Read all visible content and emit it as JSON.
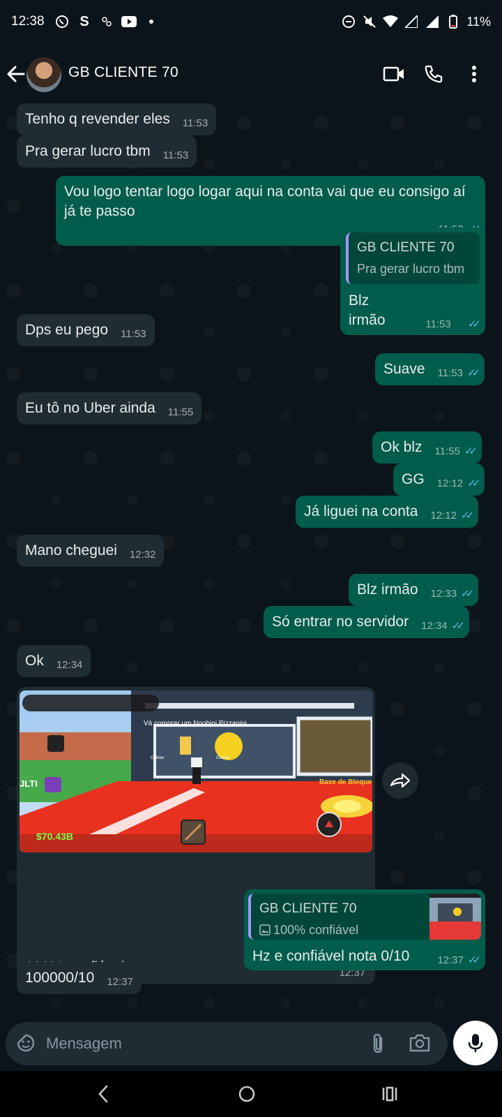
{
  "status_bar": {
    "time": "12:38",
    "battery": "11%"
  },
  "header": {
    "contact_name": "GB CLIENTE 70"
  },
  "messages": [
    {
      "dir": "in",
      "text": "Tenho q revender eles",
      "time": "11:53"
    },
    {
      "dir": "in",
      "text": "Pra gerar lucro tbm",
      "time": "11:53"
    },
    {
      "dir": "out",
      "text": "Vou logo tentar logo logar aqui na conta vai que eu consigo aí já te passo",
      "time": "11:53"
    },
    {
      "dir": "out",
      "quote_name": "GB CLIENTE 70",
      "quote_text": "Pra gerar lucro tbm",
      "text": "Blz irmão",
      "time": "11:53"
    },
    {
      "dir": "in",
      "text": "Dps eu pego",
      "time": "11:53"
    },
    {
      "dir": "out",
      "text": "Suave",
      "time": "11:53"
    },
    {
      "dir": "in",
      "text": "Eu tô no Uber ainda",
      "time": "11:55"
    },
    {
      "dir": "out",
      "text": "Ok blz",
      "time": "11:55"
    },
    {
      "dir": "out",
      "text": "GG",
      "time": "12:12"
    },
    {
      "dir": "out",
      "text": "Já liguei na conta",
      "time": "12:12"
    },
    {
      "dir": "in",
      "text": "Mano cheguei",
      "time": "12:32"
    },
    {
      "dir": "out",
      "text": "Blz irmão",
      "time": "12:33"
    },
    {
      "dir": "out",
      "text": "Só entrar no servidor",
      "time": "12:34"
    },
    {
      "dir": "in",
      "text": "Ok",
      "time": "12:34"
    },
    {
      "dir": "in",
      "caption": "100% confiável",
      "time": "12:37",
      "image_texts": {
        "banner": "Vá comprar um Noobini Pizzanini",
        "base": "Base de Bloque",
        "money": "$70.43B",
        "side": "JLTI",
        "collect1": "Coletar",
        "collect2": "Coletar"
      }
    },
    {
      "dir": "out",
      "quote_name": "GB CLIENTE 70",
      "quote_text": "100% confiável",
      "text": "Hz e confiável nota 0/10",
      "time": "12:37"
    },
    {
      "dir": "in",
      "text": "100000/10",
      "time": "12:37"
    }
  ],
  "input": {
    "placeholder": "Mensagem"
  },
  "colors": {
    "bg": "#0b141a",
    "incoming": "#202c33",
    "outgoing": "#005c4b",
    "read_ticks": "#53bdeb"
  }
}
